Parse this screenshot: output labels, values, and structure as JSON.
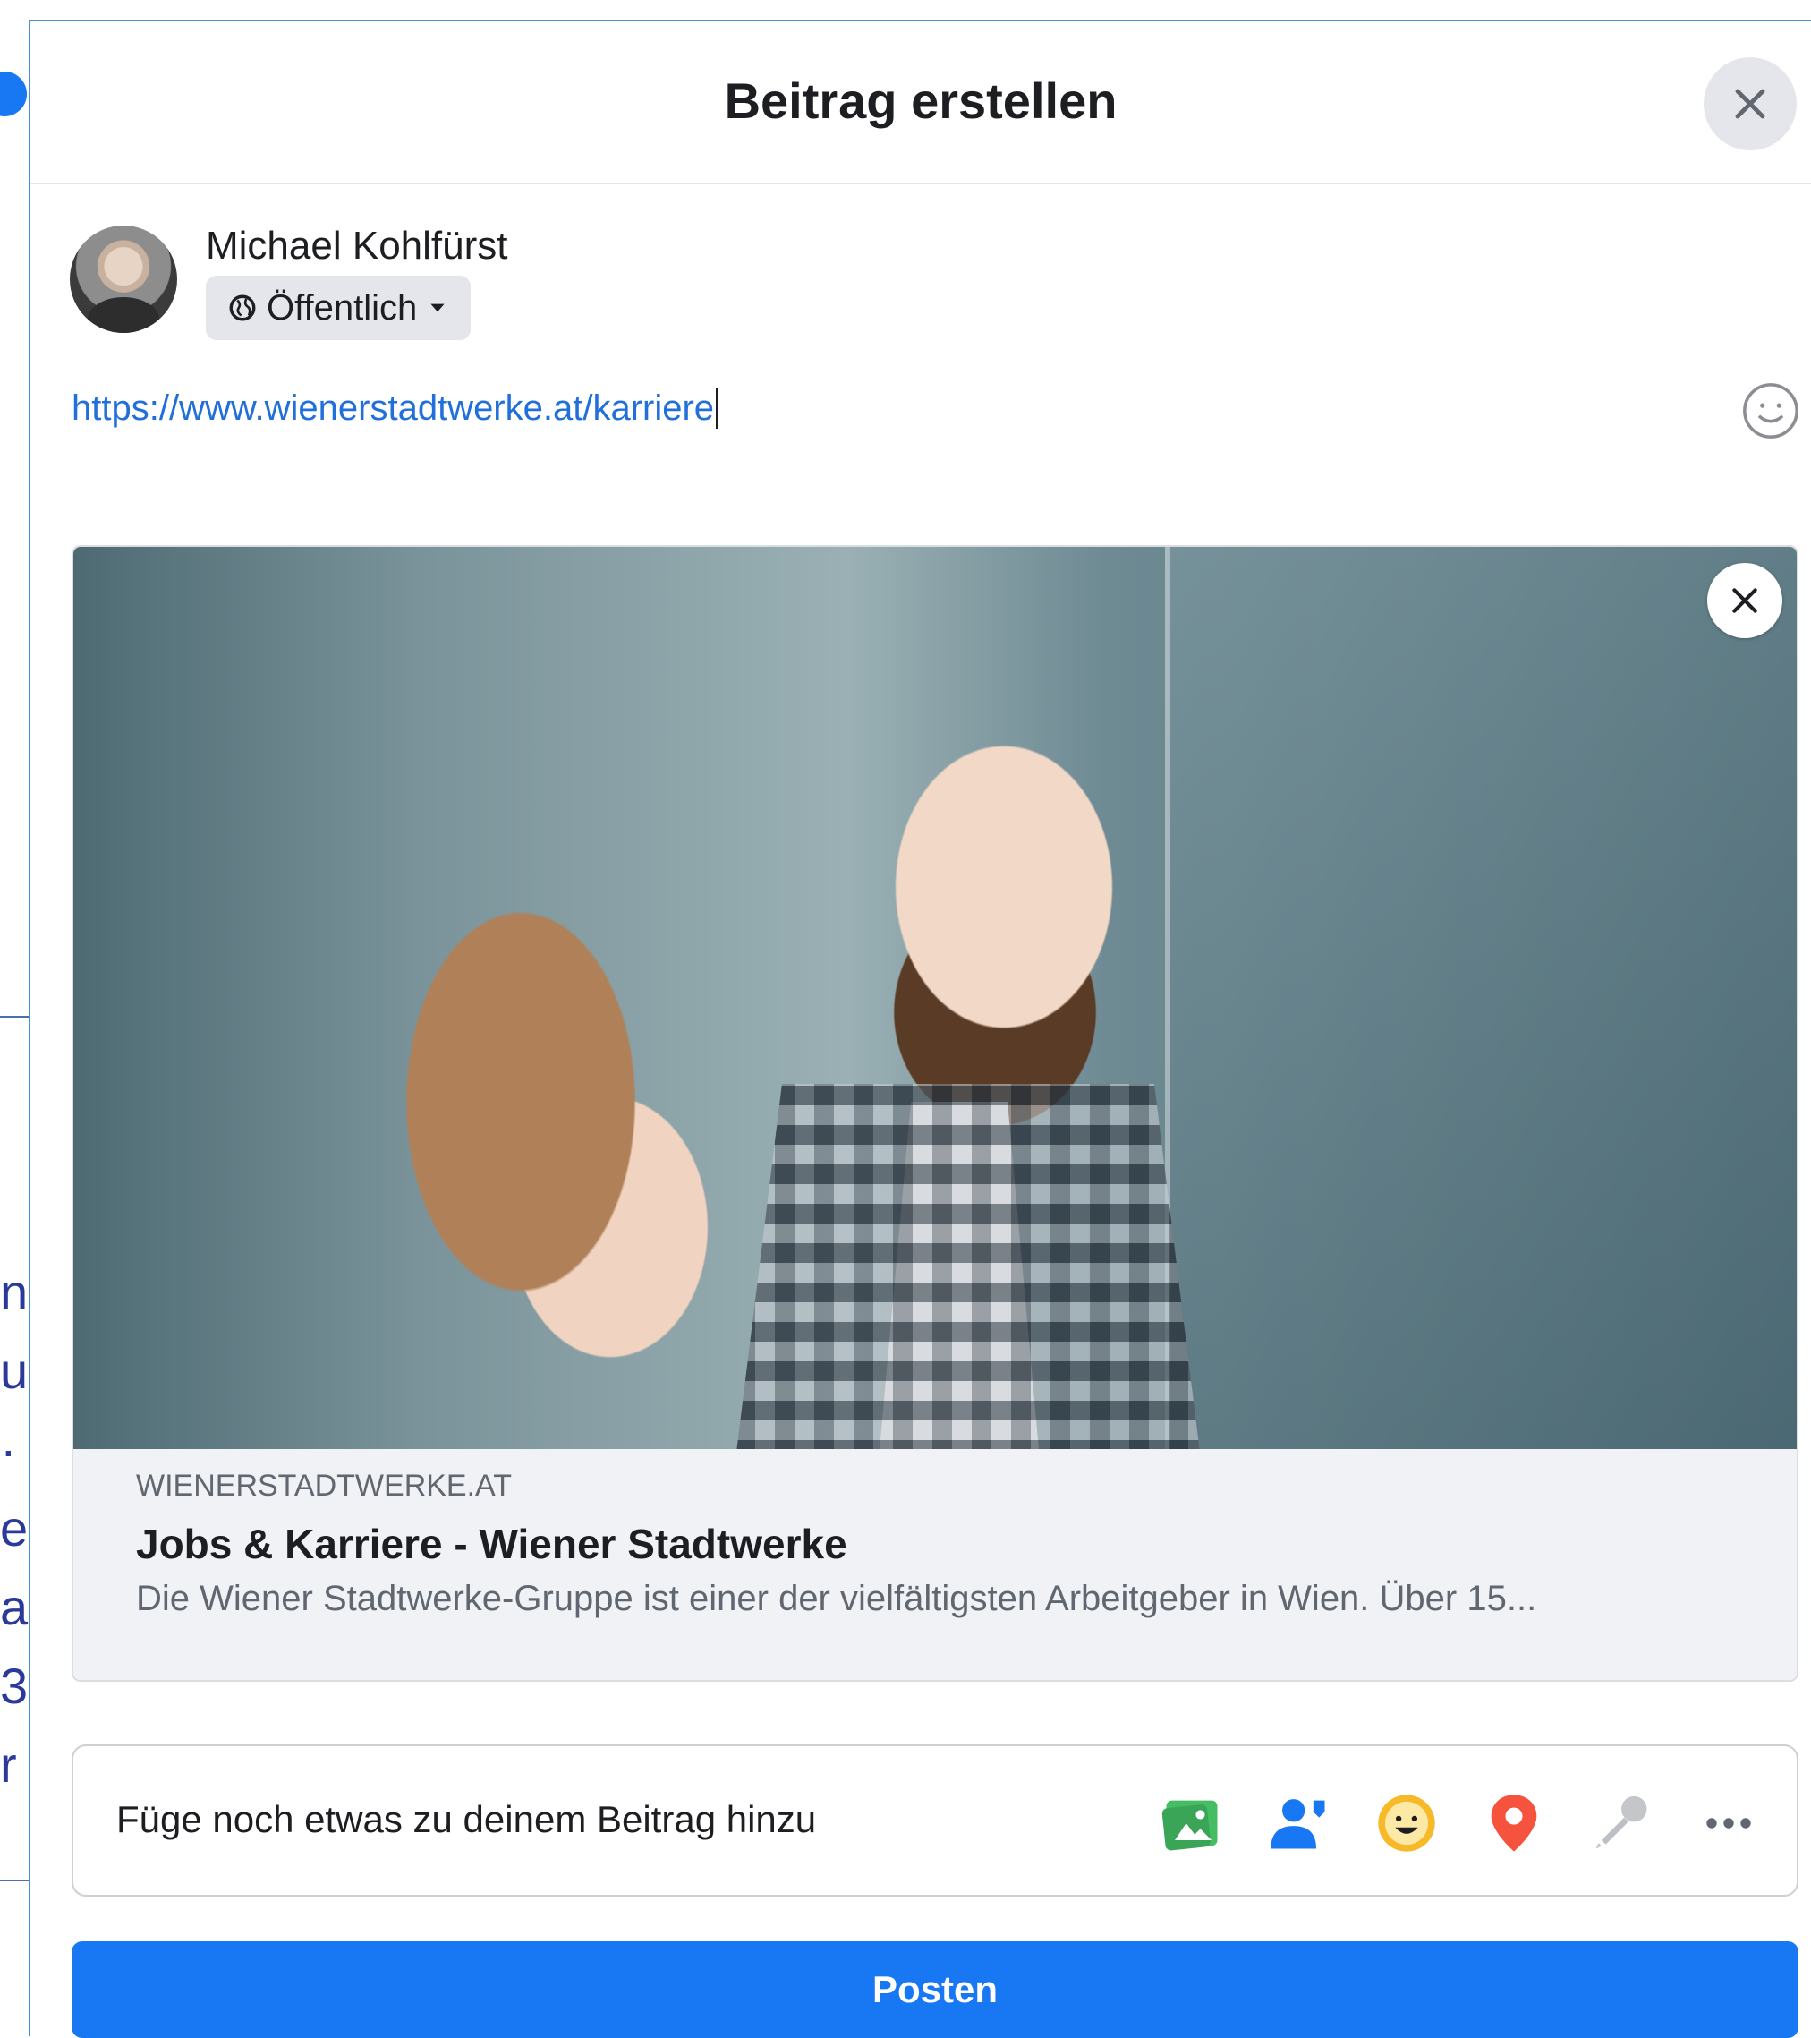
{
  "dialog": {
    "title": "Beitrag erstellen"
  },
  "user": {
    "name": "Michael Kohlfürst",
    "privacy": "Öffentlich"
  },
  "composer": {
    "text": "https://www.wienerstadtwerke.at/karriere"
  },
  "link_preview": {
    "domain": "WIENERSTADTWERKE.AT",
    "title": "Jobs & Karriere - Wiener Stadtwerke",
    "description": "Die Wiener Stadtwerke-Gruppe ist einer der vielfältigsten Arbeitgeber in Wien. Über 15..."
  },
  "add_to_post": {
    "label": "Füge noch etwas zu deinem Beitrag hinzu",
    "icons": [
      "photo-video-icon",
      "tag-people-icon",
      "feeling-activity-icon",
      "check-in-icon",
      "live-video-icon",
      "more-icon"
    ]
  },
  "actions": {
    "post_label": "Posten"
  },
  "background": {
    "letters": [
      "n",
      "u",
      "·",
      "e",
      "a",
      "3",
      "r"
    ]
  },
  "colors": {
    "primary": "#1877f2",
    "link": "#216fdb",
    "photo_green": "#45bd62",
    "tag_blue": "#1877f2",
    "feeling_yellow": "#f7b928",
    "checkin_red": "#f5533d",
    "disabled_gray": "#bcc0c4"
  }
}
